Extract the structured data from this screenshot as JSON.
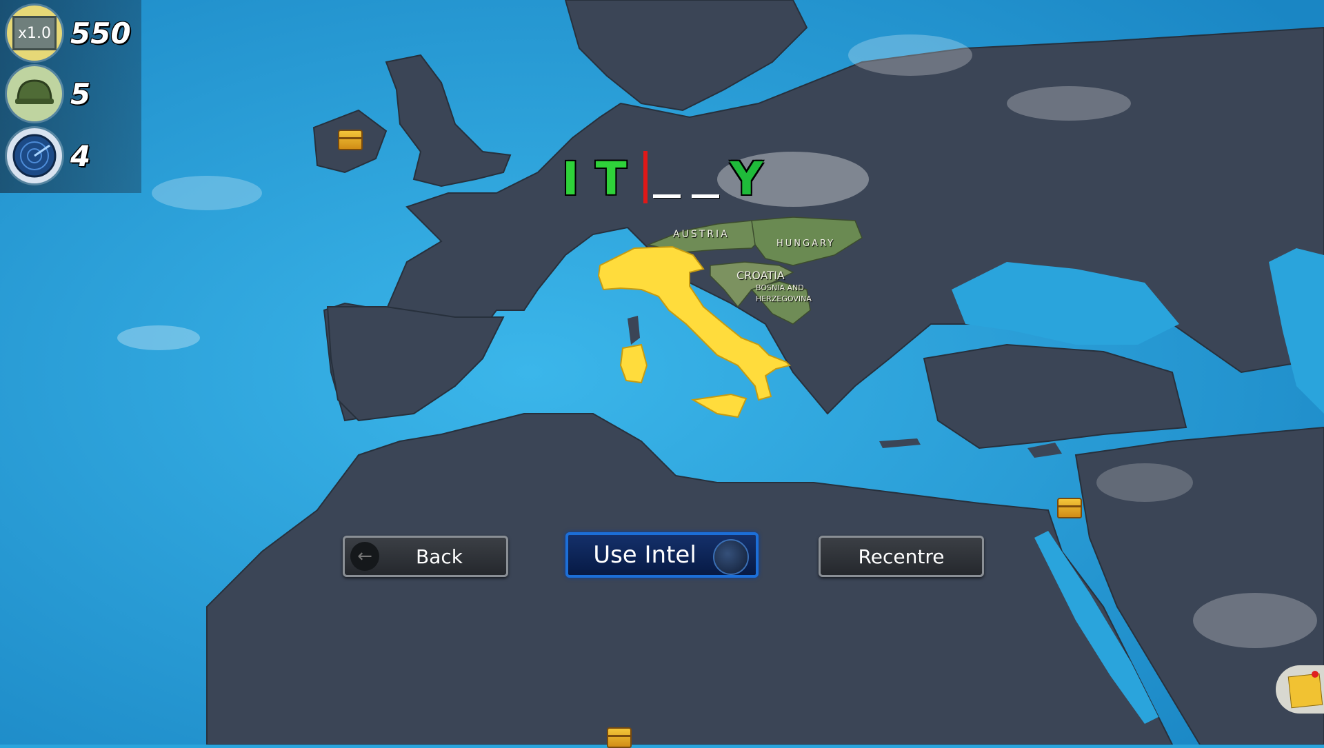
{
  "hud": {
    "multiplier": "x1.0",
    "score": "550",
    "lives": "5",
    "intel": "4"
  },
  "puzzle": {
    "letters": [
      "I",
      "T",
      "",
      "",
      "Y"
    ]
  },
  "map_labels": {
    "austria": "AUSTRIA",
    "hungary": "HUNGARY",
    "croatia": "CROATIA",
    "bosnia": "BOSNIA AND HERZEGOVINA"
  },
  "buttons": {
    "back": "Back",
    "use_intel": "Use Intel",
    "recentre": "Recentre"
  },
  "colors": {
    "sea": "#2aa4dc",
    "land": "#3b4556",
    "target_country": "#ffdc3c",
    "neighbor_country": "#6a8a52"
  },
  "icons": [
    "multiplier-icon",
    "helmet-icon",
    "radar-icon",
    "back-arrow-icon",
    "globe-icon",
    "treasure-chest-icon",
    "sticky-note-icon"
  ]
}
